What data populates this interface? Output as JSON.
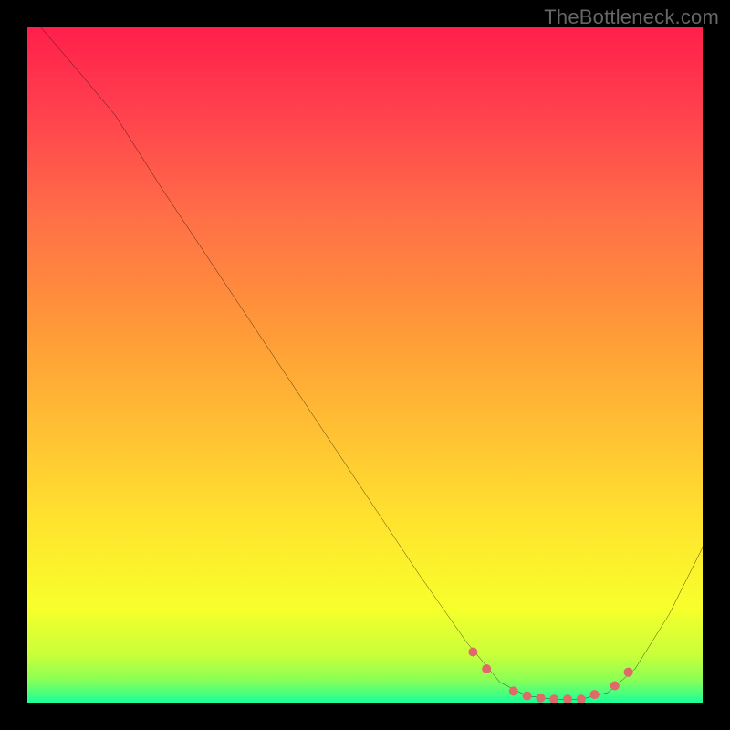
{
  "watermark": "TheBottleneck.com",
  "chart_data": {
    "type": "line",
    "title": "",
    "xlabel": "",
    "ylabel": "",
    "xlim": [
      0,
      100
    ],
    "ylim": [
      0,
      100
    ],
    "grid": false,
    "legend": false,
    "gradient_stops": [
      {
        "offset": 0,
        "color": "#ff1f4b"
      },
      {
        "offset": 0.12,
        "color": "#ff3f4e"
      },
      {
        "offset": 0.28,
        "color": "#ff6f47"
      },
      {
        "offset": 0.45,
        "color": "#ff9a38"
      },
      {
        "offset": 0.6,
        "color": "#ffc133"
      },
      {
        "offset": 0.74,
        "color": "#ffe52e"
      },
      {
        "offset": 0.86,
        "color": "#f7ff2b"
      },
      {
        "offset": 0.93,
        "color": "#c8ff3a"
      },
      {
        "offset": 0.965,
        "color": "#8cff55"
      },
      {
        "offset": 0.985,
        "color": "#4dff7a"
      },
      {
        "offset": 1.0,
        "color": "#19ff9c"
      }
    ],
    "series": [
      {
        "name": "bottleneck-curve",
        "color": "#000000",
        "stroke_width": 2,
        "points": [
          {
            "x": 2,
            "y": 100
          },
          {
            "x": 8,
            "y": 93
          },
          {
            "x": 13,
            "y": 87
          },
          {
            "x": 20,
            "y": 76
          },
          {
            "x": 30,
            "y": 61
          },
          {
            "x": 40,
            "y": 46
          },
          {
            "x": 50,
            "y": 31
          },
          {
            "x": 58,
            "y": 19
          },
          {
            "x": 65,
            "y": 9
          },
          {
            "x": 70,
            "y": 3
          },
          {
            "x": 74,
            "y": 1
          },
          {
            "x": 78,
            "y": 0.5
          },
          {
            "x": 82,
            "y": 0.5
          },
          {
            "x": 86,
            "y": 1.5
          },
          {
            "x": 90,
            "y": 5
          },
          {
            "x": 95,
            "y": 13
          },
          {
            "x": 100,
            "y": 23
          }
        ]
      },
      {
        "name": "bottleneck-markers",
        "color": "#e06a6a",
        "type": "scatter",
        "marker_radius": 5,
        "points": [
          {
            "x": 66,
            "y": 7.5
          },
          {
            "x": 68,
            "y": 5
          },
          {
            "x": 72,
            "y": 1.7
          },
          {
            "x": 74,
            "y": 1
          },
          {
            "x": 76,
            "y": 0.7
          },
          {
            "x": 78,
            "y": 0.5
          },
          {
            "x": 80,
            "y": 0.5
          },
          {
            "x": 82,
            "y": 0.5
          },
          {
            "x": 84,
            "y": 1.2
          },
          {
            "x": 87,
            "y": 2.5
          },
          {
            "x": 89,
            "y": 4.5
          }
        ]
      }
    ]
  }
}
